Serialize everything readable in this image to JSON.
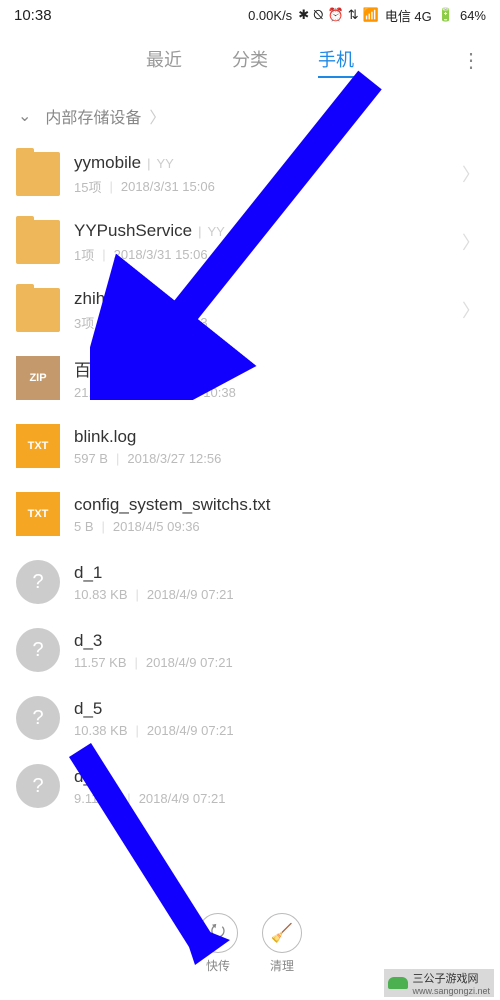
{
  "status": {
    "time": "10:38",
    "speed": "0.00K/s",
    "carrier": "电信 4G",
    "battery": "64%"
  },
  "tabs": {
    "recent": "最近",
    "category": "分类",
    "phone": "手机"
  },
  "breadcrumb": {
    "label": "内部存储设备"
  },
  "files": [
    {
      "name": "yymobile",
      "parent": "YY",
      "meta1": "15项",
      "meta2": "2018/3/31 15:06",
      "type": "folder"
    },
    {
      "name": "YYPushService",
      "parent": "YY",
      "meta1": "1项",
      "meta2": "2018/3/31 15:06",
      "type": "folder"
    },
    {
      "name": "zhihu",
      "parent": "",
      "meta1": "3项",
      "meta2": "2018/3/31 15:13",
      "type": "folder"
    },
    {
      "name": "百度经验.zip",
      "parent": "",
      "meta1": "21.43 MB",
      "meta2": "2018/4/9 10:38",
      "type": "zip"
    },
    {
      "name": "blink.log",
      "parent": "",
      "meta1": "597 B",
      "meta2": "2018/3/27 12:56",
      "type": "txt"
    },
    {
      "name": "config_system_switchs.txt",
      "parent": "",
      "meta1": "5 B",
      "meta2": "2018/4/5 09:36",
      "type": "txt"
    },
    {
      "name": "d_1",
      "parent": "",
      "meta1": "10.83 KB",
      "meta2": "2018/4/9 07:21",
      "type": "unknown"
    },
    {
      "name": "d_3",
      "parent": "",
      "meta1": "11.57 KB",
      "meta2": "2018/4/9 07:21",
      "type": "unknown"
    },
    {
      "name": "d_5",
      "parent": "",
      "meta1": "10.38 KB",
      "meta2": "2018/4/9 07:21",
      "type": "unknown"
    },
    {
      "name": "d_7",
      "parent": "",
      "meta1": "9.11 KB",
      "meta2": "2018/4/9 07:21",
      "type": "unknown"
    }
  ],
  "icons": {
    "zip": "ZIP",
    "txt": "TXT",
    "unknown": "?"
  },
  "bottom": {
    "transfer": "快传",
    "clean": "清理"
  },
  "watermark": {
    "text": "三公子游戏网",
    "url": "www.sangongzi.net"
  }
}
